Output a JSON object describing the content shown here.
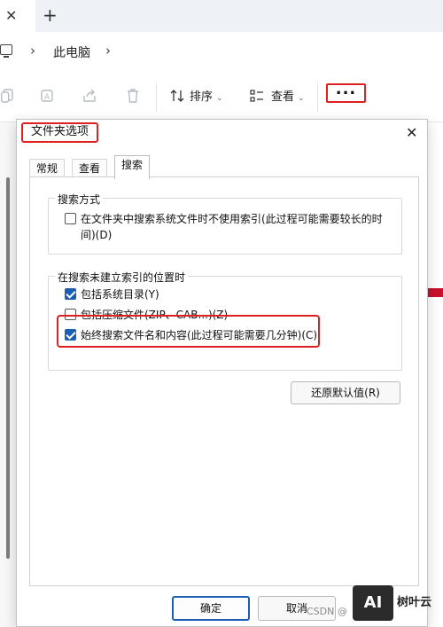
{
  "explorer": {
    "tab_close": "✕",
    "new_tab": "+",
    "breadcrumb": {
      "location": "此电脑",
      "separator": "›"
    },
    "toolbar": {
      "sort_label": "排序",
      "view_label": "查看",
      "more_label": "..."
    }
  },
  "dialog": {
    "title": "文件夹选项",
    "close": "✕",
    "tabs": [
      {
        "label": "常规",
        "active": false
      },
      {
        "label": "查看",
        "active": false
      },
      {
        "label": "搜索",
        "active": true
      }
    ],
    "group_search_method": {
      "legend": "搜索方式",
      "options": [
        {
          "label_line1": "在文件夹中搜索系统文件时不使用索引(此过程可能需要较长的时",
          "label_line2": "间)(D)",
          "checked": false
        }
      ]
    },
    "group_non_indexed": {
      "legend": "在搜索未建立索引的位置时",
      "options": [
        {
          "label": "包括系统目录(Y)",
          "checked": true
        },
        {
          "label": "包括压缩文件(ZIP、CAB...)(Z)",
          "checked": false
        },
        {
          "label": "始终搜索文件名和内容(此过程可能需要几分钟)(C)",
          "checked": true
        }
      ]
    },
    "restore_defaults_label": "还原默认值(R)",
    "ok_label": "确定",
    "cancel_label": "取消"
  },
  "watermark": {
    "text": "CSDN @",
    "logo": "AI",
    "brand": "树叶云"
  },
  "colors": {
    "highlight_red": "#e02020",
    "accent_blue": "#1a5fb4"
  }
}
